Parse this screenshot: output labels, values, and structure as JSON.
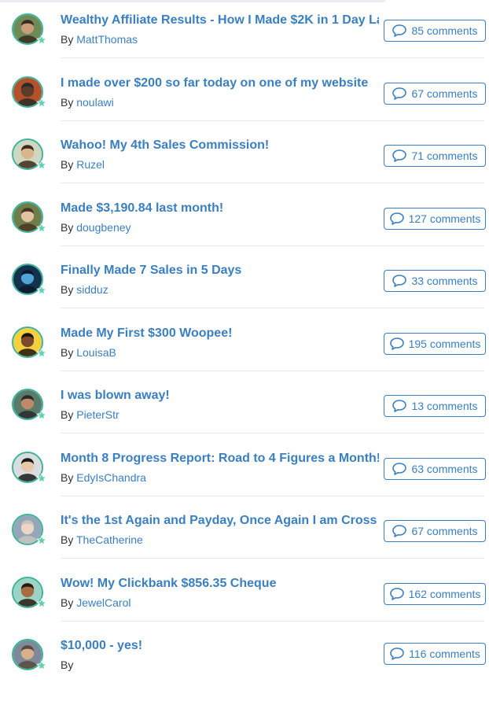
{
  "colors": {
    "link": "#3a7fc1",
    "avatar_ring": "#3bb39a",
    "star": "#5fd1b5"
  },
  "posts": [
    {
      "title": "Wealthy Affiliate Results - How I Made $2K in 1 Day La",
      "by": "By",
      "author": "MattThomas",
      "comments": "85 comments",
      "avatar_icon": "user-photo-icon"
    },
    {
      "title": "I made over $200 so far today on one of my website",
      "by": "By",
      "author": "noulawi",
      "comments": "67 comments",
      "avatar_icon": "user-photo-icon"
    },
    {
      "title": "Wahoo! My 4th Sales Commission!",
      "by": "By",
      "author": "Ruzel",
      "comments": "71 comments",
      "avatar_icon": "user-photo-icon"
    },
    {
      "title": "Made $3,190.84 last month!",
      "by": "By",
      "author": "dougbeney",
      "comments": "127 comments",
      "avatar_icon": "user-photo-icon"
    },
    {
      "title": "Finally Made 7 Sales in 5 Days",
      "by": "By",
      "author": "sidduz",
      "comments": "33 comments",
      "avatar_icon": "user-photo-icon"
    },
    {
      "title": "Made My First $300 Woopee!",
      "by": "By",
      "author": "LouisaB",
      "comments": "195 comments",
      "avatar_icon": "user-photo-icon"
    },
    {
      "title": "I was blown away!",
      "by": "By",
      "author": "PieterStr",
      "comments": "13 comments",
      "avatar_icon": "user-photo-icon"
    },
    {
      "title": "Month 8 Progress Report: Road to 4 Figures a Month!",
      "by": "By",
      "author": "EdyIsChandra",
      "comments": "63 comments",
      "avatar_icon": "user-photo-icon"
    },
    {
      "title": "It's the 1st Again and Payday, Once Again I am Cross",
      "by": "By",
      "author": "TheCatherine",
      "comments": "67 comments",
      "avatar_icon": "user-photo-icon"
    },
    {
      "title": "Wow! My Clickbank $856.35 Cheque",
      "by": "By",
      "author": "JewelCarol",
      "comments": "162 comments",
      "avatar_icon": "user-photo-icon"
    },
    {
      "title": "$10,000 - yes!",
      "by": "By",
      "author": "",
      "comments": "116 comments",
      "avatar_icon": "user-photo-icon"
    }
  ]
}
